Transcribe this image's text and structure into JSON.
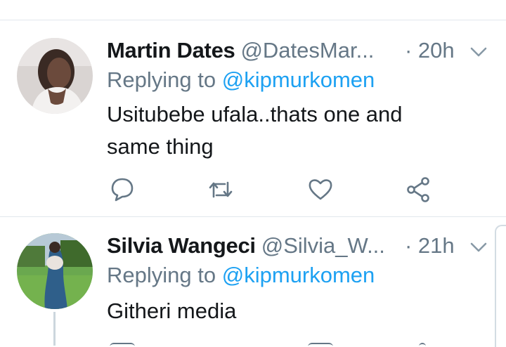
{
  "tweets": [
    {
      "name": "Martin Dates",
      "handle": "@DatesMar...",
      "time": "· 20h",
      "reply_prefix": "Replying to ",
      "reply_to": "@kipmurkomen",
      "text": "Usitubebe ufala..thats one and same thing"
    },
    {
      "name": "Silvia Wangeci",
      "handle": "@Silvia_W...",
      "time": "· 21h",
      "reply_prefix": "Replying to ",
      "reply_to": "@kipmurkomen",
      "text": "Githeri media"
    }
  ],
  "icons": [
    "reply-icon",
    "retweet-icon",
    "like-icon",
    "share-icon",
    "chevron-down-icon"
  ],
  "colors": {
    "accent": "#1da1f2",
    "secondary_text": "#657786",
    "divider": "#e1e8ed",
    "icon": "#657786"
  }
}
